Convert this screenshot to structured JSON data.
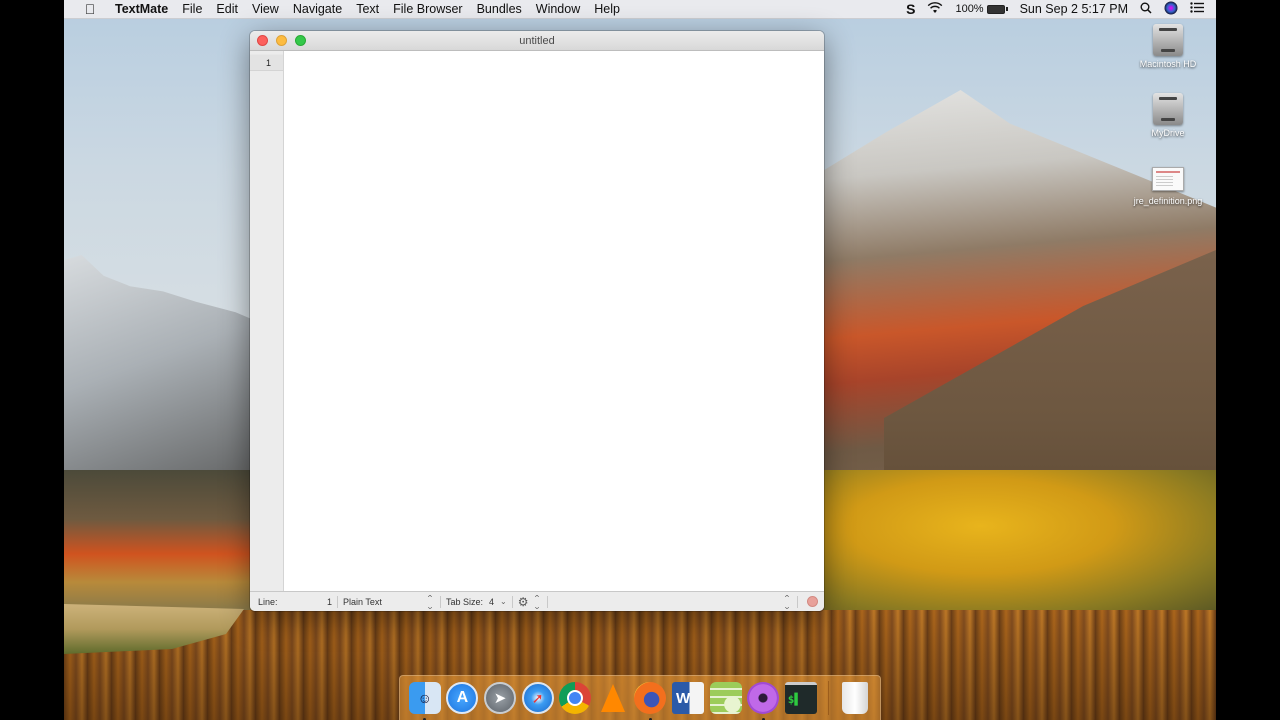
{
  "menubar": {
    "apple_icon": "apple-icon",
    "app_name": "TextMate",
    "menus": [
      "File",
      "Edit",
      "View",
      "Navigate",
      "Text",
      "File Browser",
      "Bundles",
      "Window",
      "Help"
    ],
    "status": {
      "s_glyph": "S",
      "battery_percent": "100%",
      "datetime": "Sun Sep 2  5:17 PM"
    }
  },
  "window": {
    "title": "untitled",
    "line_numbers": [
      "1"
    ],
    "content": "",
    "statusbar": {
      "line_label": "Line:",
      "line_value": "1",
      "grammar": "Plain Text",
      "tab_size_label": "Tab Size:",
      "tab_size_value": "4"
    }
  },
  "desktop_icons": [
    {
      "label": "Macintosh HD",
      "type": "drive"
    },
    {
      "label": "MyDrive",
      "type": "drive"
    },
    {
      "label": "jre_definition.png",
      "type": "image"
    }
  ],
  "dock": {
    "items": [
      {
        "name": "Finder",
        "running": true
      },
      {
        "name": "App Store",
        "running": false
      },
      {
        "name": "Launchpad",
        "running": false
      },
      {
        "name": "Safari",
        "running": false
      },
      {
        "name": "Google Chrome",
        "running": false
      },
      {
        "name": "VLC",
        "running": false
      },
      {
        "name": "Firefox",
        "running": true
      },
      {
        "name": "Microsoft Word",
        "running": false
      },
      {
        "name": "Database Browser",
        "running": false
      },
      {
        "name": "Flower App",
        "running": true
      },
      {
        "name": "Terminal",
        "running": false
      }
    ],
    "trash": "Trash",
    "terminal_glyph": "$▌",
    "word_glyph": "W"
  }
}
